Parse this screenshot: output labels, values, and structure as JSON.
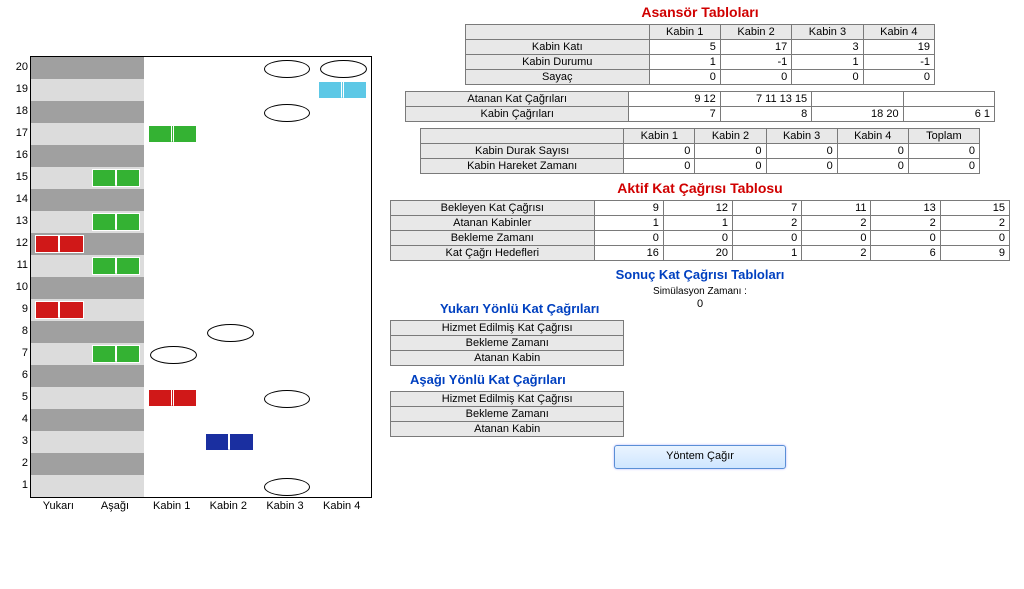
{
  "chart_data": {
    "type": "grid",
    "floors": [
      20,
      19,
      18,
      17,
      16,
      15,
      14,
      13,
      12,
      11,
      10,
      9,
      8,
      7,
      6,
      5,
      4,
      3,
      2,
      1
    ],
    "columns": [
      "Yukarı",
      "Aşağı",
      "Kabin 1",
      "Kabin 2",
      "Kabin 3",
      "Kabin 4"
    ],
    "shaded_columns": [
      "Yukarı",
      "Aşağı"
    ],
    "envelopes": [
      {
        "col": "Yukarı",
        "floor": 12,
        "color": "#d01818"
      },
      {
        "col": "Yukarı",
        "floor": 9,
        "color": "#d01818"
      },
      {
        "col": "Aşağı",
        "floor": 15,
        "color": "#34b233"
      },
      {
        "col": "Aşağı",
        "floor": 13,
        "color": "#34b233"
      },
      {
        "col": "Aşağı",
        "floor": 11,
        "color": "#34b233"
      },
      {
        "col": "Aşağı",
        "floor": 7,
        "color": "#34b233"
      },
      {
        "col": "Kabin 1",
        "floor": 17,
        "color": "#34b233"
      },
      {
        "col": "Kabin 1",
        "floor": 5,
        "color": "#d01818"
      },
      {
        "col": "Kabin 2",
        "floor": 3,
        "color": "#1a2fa0"
      },
      {
        "col": "Kabin 4",
        "floor": 19,
        "color": "#5dc8e6"
      }
    ],
    "markers": [
      {
        "col": "Kabin 1",
        "floor": 7
      },
      {
        "col": "Kabin 2",
        "floor": 8
      },
      {
        "col": "Kabin 3",
        "floor": 20
      },
      {
        "col": "Kabin 3",
        "floor": 18
      },
      {
        "col": "Kabin 3",
        "floor": 5
      },
      {
        "col": "Kabin 3",
        "floor": 1
      },
      {
        "col": "Kabin 4",
        "floor": 20
      }
    ]
  },
  "titles": {
    "asansor": "Asansör Tabloları",
    "aktif": "Aktif Kat Çağrısı Tablosu",
    "sonuc": "Sonuç Kat Çağrısı Tabloları",
    "yukari": "Yukarı Yönlü Kat Çağrıları",
    "asagi": "Aşağı Yönlü Kat Çağrıları"
  },
  "sim_label": "Simülasyon Zamanı :",
  "sim_value": "0",
  "t1": {
    "head": [
      "",
      "Kabin 1",
      "Kabin 2",
      "Kabin 3",
      "Kabin 4"
    ],
    "rows": [
      {
        "lbl": "Kabin Katı",
        "v": [
          "5",
          "17",
          "3",
          "19"
        ]
      },
      {
        "lbl": "Kabin Durumu",
        "v": [
          "1",
          "-1",
          "1",
          "-1"
        ]
      },
      {
        "lbl": "Sayaç",
        "v": [
          "0",
          "0",
          "0",
          "0"
        ]
      }
    ]
  },
  "t2": {
    "rows": [
      {
        "lbl": "Atanan Kat Çağrıları",
        "v": [
          "9  12",
          "7  11  13  15",
          "",
          ""
        ]
      },
      {
        "lbl": "Kabin Çağrıları",
        "v": [
          "7",
          "8",
          "18  20",
          "6  1"
        ]
      }
    ]
  },
  "t3": {
    "head": [
      "",
      "Kabin 1",
      "Kabin 2",
      "Kabin 3",
      "Kabin 4",
      "Toplam"
    ],
    "rows": [
      {
        "lbl": "Kabin Durak Sayısı",
        "v": [
          "0",
          "0",
          "0",
          "0",
          "0"
        ]
      },
      {
        "lbl": "Kabin Hareket Zamanı",
        "v": [
          "0",
          "0",
          "0",
          "0",
          "0"
        ]
      }
    ]
  },
  "t4": {
    "rows": [
      {
        "lbl": "Bekleyen Kat Çağrısı",
        "v": [
          "9",
          "12",
          "7",
          "11",
          "13",
          "15"
        ]
      },
      {
        "lbl": "Atanan Kabinler",
        "v": [
          "1",
          "1",
          "2",
          "2",
          "2",
          "2"
        ]
      },
      {
        "lbl": "Bekleme Zamanı",
        "v": [
          "0",
          "0",
          "0",
          "0",
          "0",
          "0"
        ]
      },
      {
        "lbl": "Kat Çağrı Hedefleri",
        "v": [
          "16",
          "20",
          "1",
          "2",
          "6",
          "9"
        ]
      }
    ]
  },
  "t5": {
    "rows": [
      {
        "lbl": "Hizmet Edilmiş Kat Çağrısı"
      },
      {
        "lbl": "Bekleme Zamanı"
      },
      {
        "lbl": "Atanan Kabin"
      }
    ]
  },
  "t6": {
    "rows": [
      {
        "lbl": "Hizmet Edilmiş Kat Çağrısı"
      },
      {
        "lbl": "Bekleme Zamanı"
      },
      {
        "lbl": "Atanan Kabin"
      }
    ]
  },
  "button": "Yöntem Çağır"
}
